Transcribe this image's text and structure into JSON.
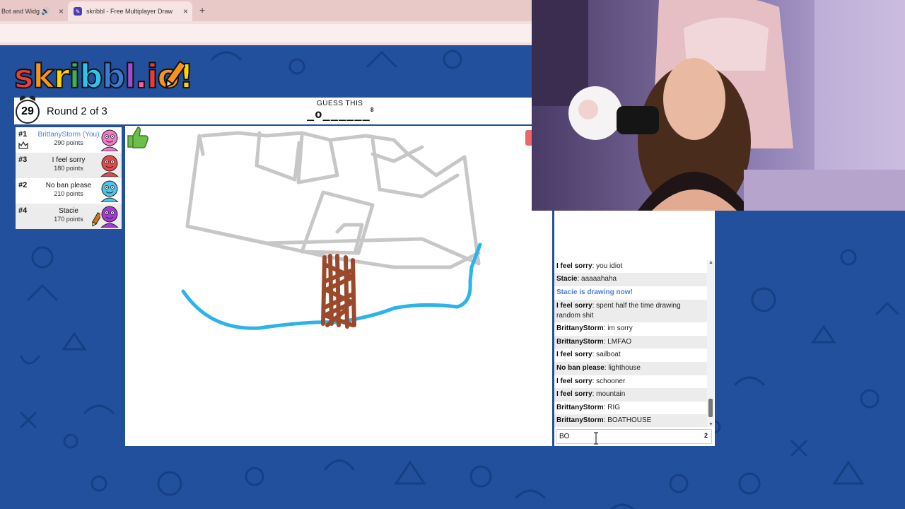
{
  "browser": {
    "tabs": [
      {
        "label": "Bot and Widg",
        "active": false
      },
      {
        "label": "skribbl - Free Multiplayer Draw",
        "active": true
      }
    ],
    "new_tab": "+",
    "close": "×"
  },
  "game": {
    "logo": [
      "s",
      "k",
      "r",
      "i",
      "b",
      "b",
      "l",
      ".",
      "i",
      "o",
      "!"
    ],
    "logo_colors": [
      "#ef3b36",
      "#f7941e",
      "#ffd400",
      "#3cb44b",
      "#2ec4f0",
      "#3a7bd5",
      "#a24ccf",
      "#ff5ea8",
      "#ef3b36",
      "#f7941e",
      "#ffd400"
    ],
    "timer": "29",
    "round": "Round 2 of 3",
    "guess_label": "GUESS THIS",
    "word_hint": "_o______",
    "word_length": "8"
  },
  "players": [
    {
      "rank": "#1",
      "name": "BrittanyStorm (You)",
      "points": "290 points",
      "me": true,
      "avatar_color": "#f07ac6",
      "crown": true,
      "drawing": false
    },
    {
      "rank": "#3",
      "name": "I feel sorry",
      "points": "180 points",
      "me": false,
      "avatar_color": "#e24a4a",
      "crown": false,
      "drawing": false
    },
    {
      "rank": "#2",
      "name": "No ban please",
      "points": "210 points",
      "me": false,
      "avatar_color": "#4fc3e8",
      "crown": false,
      "drawing": false
    },
    {
      "rank": "#4",
      "name": "Stacie",
      "points": "170 points",
      "me": false,
      "avatar_color": "#a23ad8",
      "crown": false,
      "drawing": true
    }
  ],
  "chat": {
    "messages": [
      {
        "author": "I feel sorry",
        "text": "you idiot",
        "system": false
      },
      {
        "author": "Stacie",
        "text": "aaaaahaha",
        "system": false
      },
      {
        "author": "",
        "text": "Stacie is drawing now!",
        "system": true
      },
      {
        "author": "I feel sorry",
        "text": "spent half the time drawing random shit",
        "system": false
      },
      {
        "author": "BrittanyStorm",
        "text": "im sorry",
        "system": false
      },
      {
        "author": "BrittanyStorm",
        "text": "LMFAO",
        "system": false
      },
      {
        "author": "I feel sorry",
        "text": "sailboat",
        "system": false
      },
      {
        "author": "No ban please",
        "text": "lighthouse",
        "system": false
      },
      {
        "author": "I feel sorry",
        "text": "schooner",
        "system": false
      },
      {
        "author": "I feel sorry",
        "text": "mountain",
        "system": false
      },
      {
        "author": "BrittanyStorm",
        "text": "RIG",
        "system": false
      },
      {
        "author": "BrittanyStorm",
        "text": "BOATHOUSE",
        "system": false
      }
    ],
    "input_value": "BO",
    "char_count": "2"
  },
  "colors": {
    "background": "#22509c",
    "accent": "#4a7fd4",
    "stroke_gray": "#c7c7c7",
    "stroke_blue": "#2bb3ea",
    "stroke_brown": "#9a4a2a"
  }
}
